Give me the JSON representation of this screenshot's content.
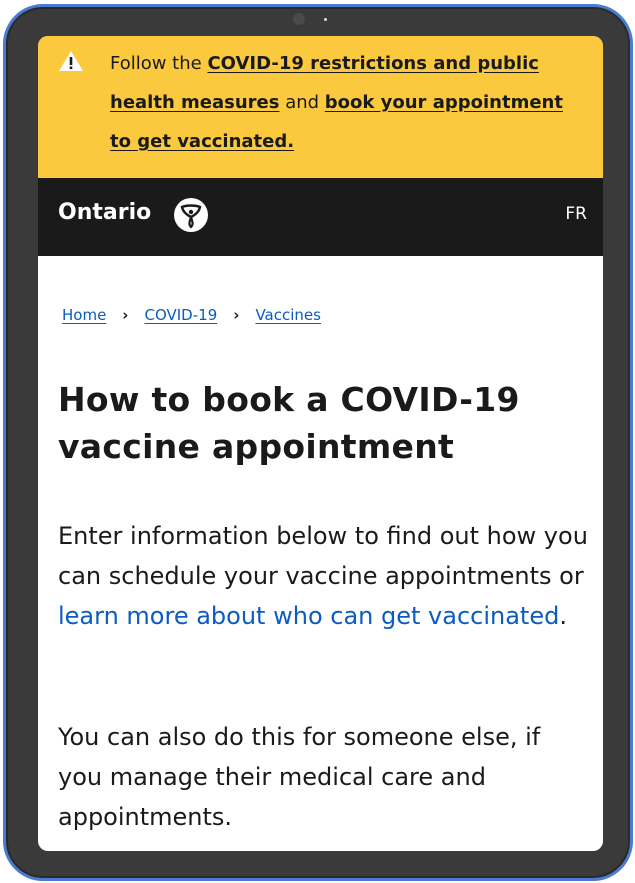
{
  "alert": {
    "prefix": "Follow the ",
    "link1": "COVID-19 restrictions and public health measures",
    "middle": " and ",
    "link2": "book your appointment to get vaccinated.",
    "icon": "warning-icon",
    "color": "#fbc93e"
  },
  "header": {
    "logo_text": "Ontario",
    "logo_icon": "trillium-icon",
    "language_toggle": "FR",
    "color": "#1a1a1a"
  },
  "breadcrumb": {
    "items": [
      "Home",
      "COVID-19",
      "Vaccines"
    ],
    "separator": "›"
  },
  "main": {
    "title": "How to book a COVID-19 vaccine appointment",
    "para1_text": "Enter information below to find out how you can schedule your vaccine appointments or ",
    "para1_link": "learn more about who can get vaccinated",
    "para1_end": ".",
    "para2": "You can also do this for someone else, if you manage their medical care and appointments.",
    "link_color": "#0b5cc1"
  }
}
